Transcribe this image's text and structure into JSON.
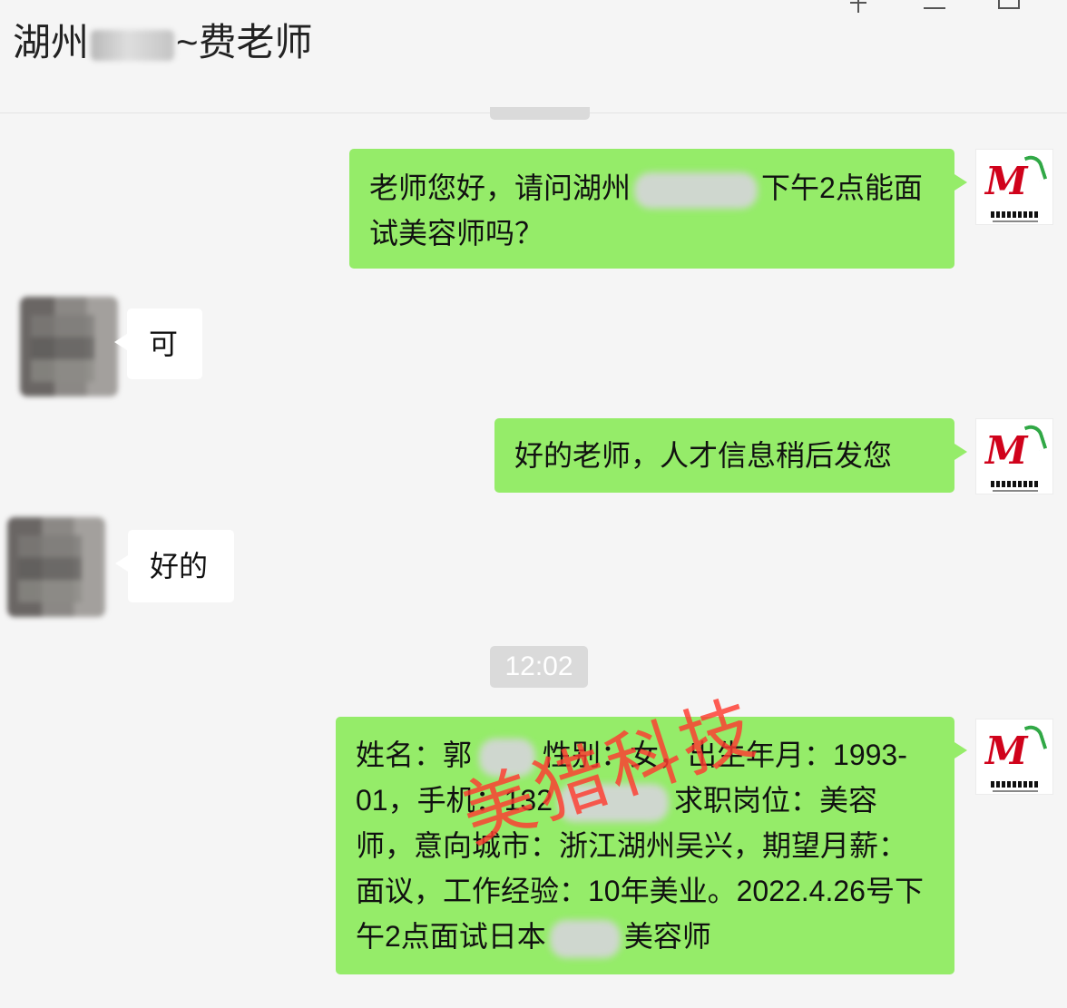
{
  "header": {
    "title_prefix": "湖州",
    "title_suffix": "~费老师"
  },
  "chat": {
    "time_divider": "12:02",
    "messages": [
      {
        "side": "right",
        "text_before": "老师您好，请问湖州",
        "text_after": "下午2点能面试美容师吗？"
      },
      {
        "side": "left",
        "text": "可"
      },
      {
        "side": "right",
        "text": "好的老师，人才信息稍后发您"
      },
      {
        "side": "left",
        "text": "好的"
      },
      {
        "side": "right",
        "text_part1": "姓名：郭",
        "text_part2": "性别：女，出生年月：1993-01，手机：132",
        "text_part3": "求职岗位：美容师，意向城市：浙江湖州吴兴，期望月薪：面议，工作经验：10年美业。2022.4.26号下午2点面试日本",
        "text_part4": "美容师"
      }
    ]
  },
  "watermark": "美猎科技",
  "colors": {
    "sent_bubble": "#95ec69",
    "received_bubble": "#ffffff",
    "background": "#f5f5f5",
    "watermark": "#ff3b30"
  },
  "icons": [
    "pin-icon",
    "minimize-icon",
    "maximize-icon",
    "brand-avatar-icon"
  ]
}
